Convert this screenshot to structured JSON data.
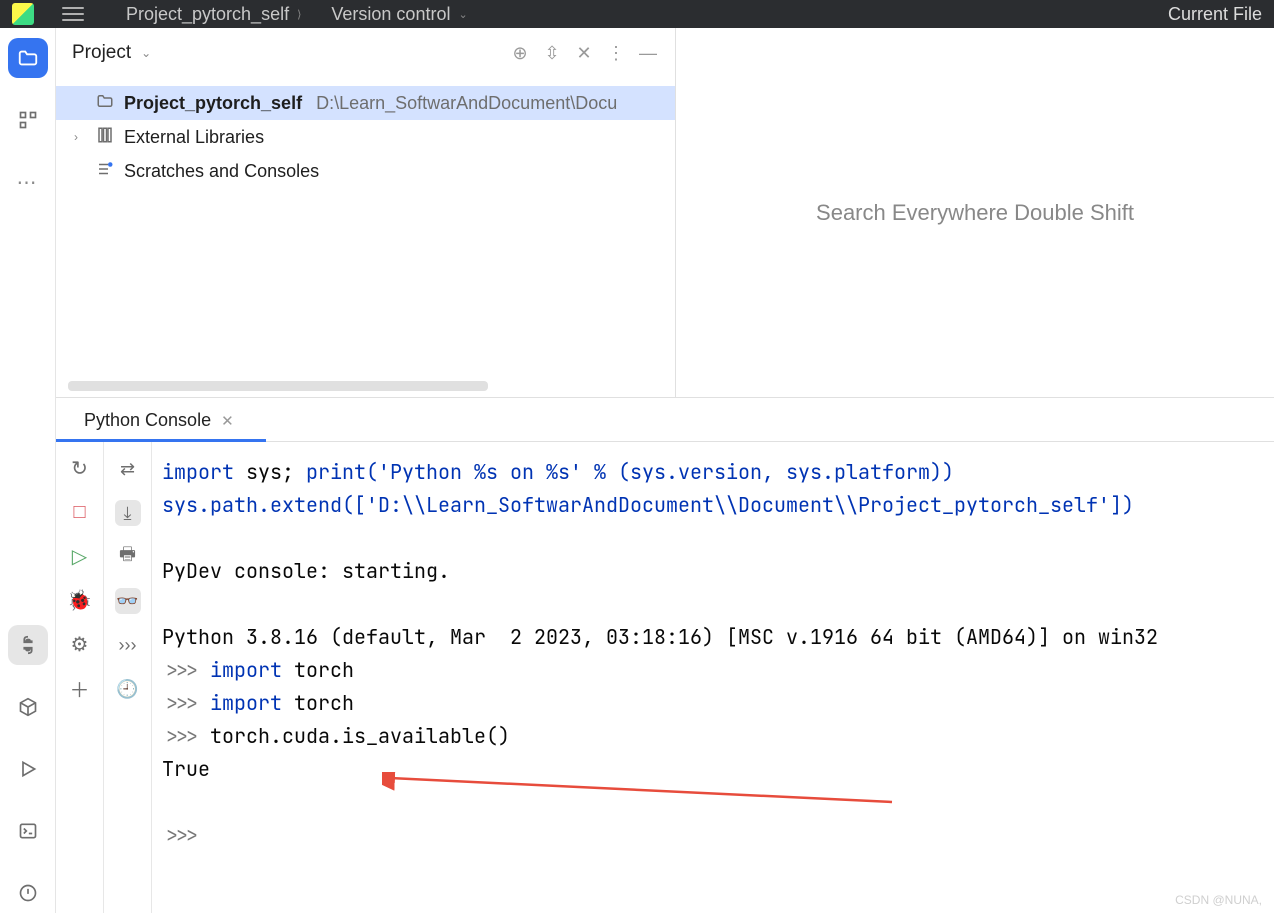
{
  "topbar": {
    "project_name": "Project_pytorch_self",
    "version_control": "Version control",
    "current_file": "Current File"
  },
  "project_panel": {
    "title": "Project",
    "root_name": "Project_pytorch_self",
    "root_path": "D:\\Learn_SoftwarAndDocument\\Docu",
    "external_libs": "External Libraries",
    "scratches": "Scratches and Consoles"
  },
  "editor_placeholder": "Search Everywhere Double Shift",
  "console_tab": "Python Console",
  "console": {
    "line1_a": "import",
    "line1_b": " sys; ",
    "line1_c": "print",
    "line1_d": "('Python %s on %s' % (sys.version, sys.platform))",
    "line2": "sys.path.extend(['D:\\\\Learn_SoftwarAndDocument\\\\Document\\\\Project_pytorch_self'])",
    "line3": "PyDev console: starting.",
    "line4": "Python 3.8.16 (default, Mar  2 2023, 03:18:16) [MSC v.1916 64 bit (AMD64)] on win32",
    "p": ">>> ",
    "imp": "import",
    "torch": " torch",
    "cuda_call": "torch.cuda.is_available()",
    "true": "True"
  },
  "watermark": "CSDN @NUNA,"
}
